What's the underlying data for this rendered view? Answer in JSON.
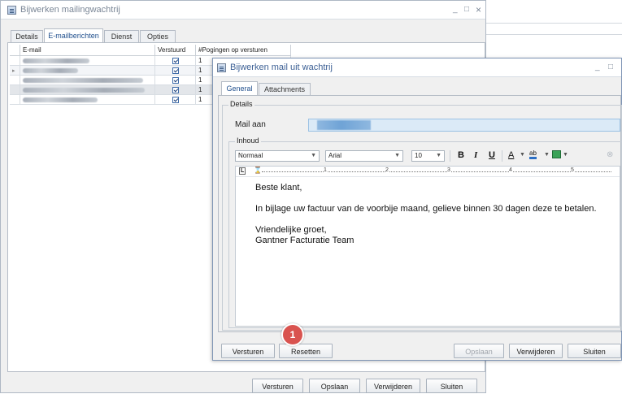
{
  "back_window": {
    "title": "Bijwerken mailingwachtrij",
    "controls": {
      "minimize": "_",
      "maximize": "□",
      "close": "×"
    },
    "tabs": [
      "Details",
      "E-mailberichten",
      "Dienst",
      "Opties"
    ],
    "active_tab": "E-mailberichten",
    "table": {
      "columns": [
        "E-mail",
        "Verstuurd",
        "#Pogingen op versturen"
      ],
      "rows": [
        {
          "sent": true,
          "attempts": "1"
        },
        {
          "sent": true,
          "attempts": "1"
        },
        {
          "sent": true,
          "attempts": "1"
        },
        {
          "sent": true,
          "attempts": "1"
        },
        {
          "sent": true,
          "attempts": "1"
        }
      ]
    },
    "buttons": {
      "send": "Versturen",
      "save": "Opslaan",
      "delete": "Verwijderen",
      "close": "Sluiten"
    }
  },
  "front_window": {
    "title": "Bijwerken mail uit wachtrij",
    "controls": {
      "minimize": "_",
      "maximize": "□"
    },
    "tabs": [
      "General",
      "Attachments"
    ],
    "active_tab": "General",
    "details_legend": "Details",
    "mail_to_label": "Mail aan",
    "content_legend": "Inhoud",
    "toolbar": {
      "style": "Normaal",
      "font": "Arial",
      "size": "10",
      "bold": "B",
      "italic": "I",
      "underline": "U",
      "font_color": "A",
      "highlight": "ab"
    },
    "ruler_marks": [
      "1",
      "2",
      "3",
      "4",
      "5"
    ],
    "body": {
      "greeting": "Beste klant,",
      "paragraph": "In bijlage uw factuur van de voorbije maand, gelieve binnen 30 dagen deze te betalen.",
      "closing": "Vriendelijke groet,",
      "signature": "Gantner Facturatie Team"
    },
    "buttons": {
      "send": "Versturen",
      "reset": "Resetten",
      "save": "Opslaan",
      "delete": "Verwijderen",
      "close": "Sluiten"
    },
    "callout_number": "1"
  },
  "colors": {
    "accent": "#1f4e8c",
    "callout": "#d9534f",
    "mail_field": "#dbeaf7"
  }
}
